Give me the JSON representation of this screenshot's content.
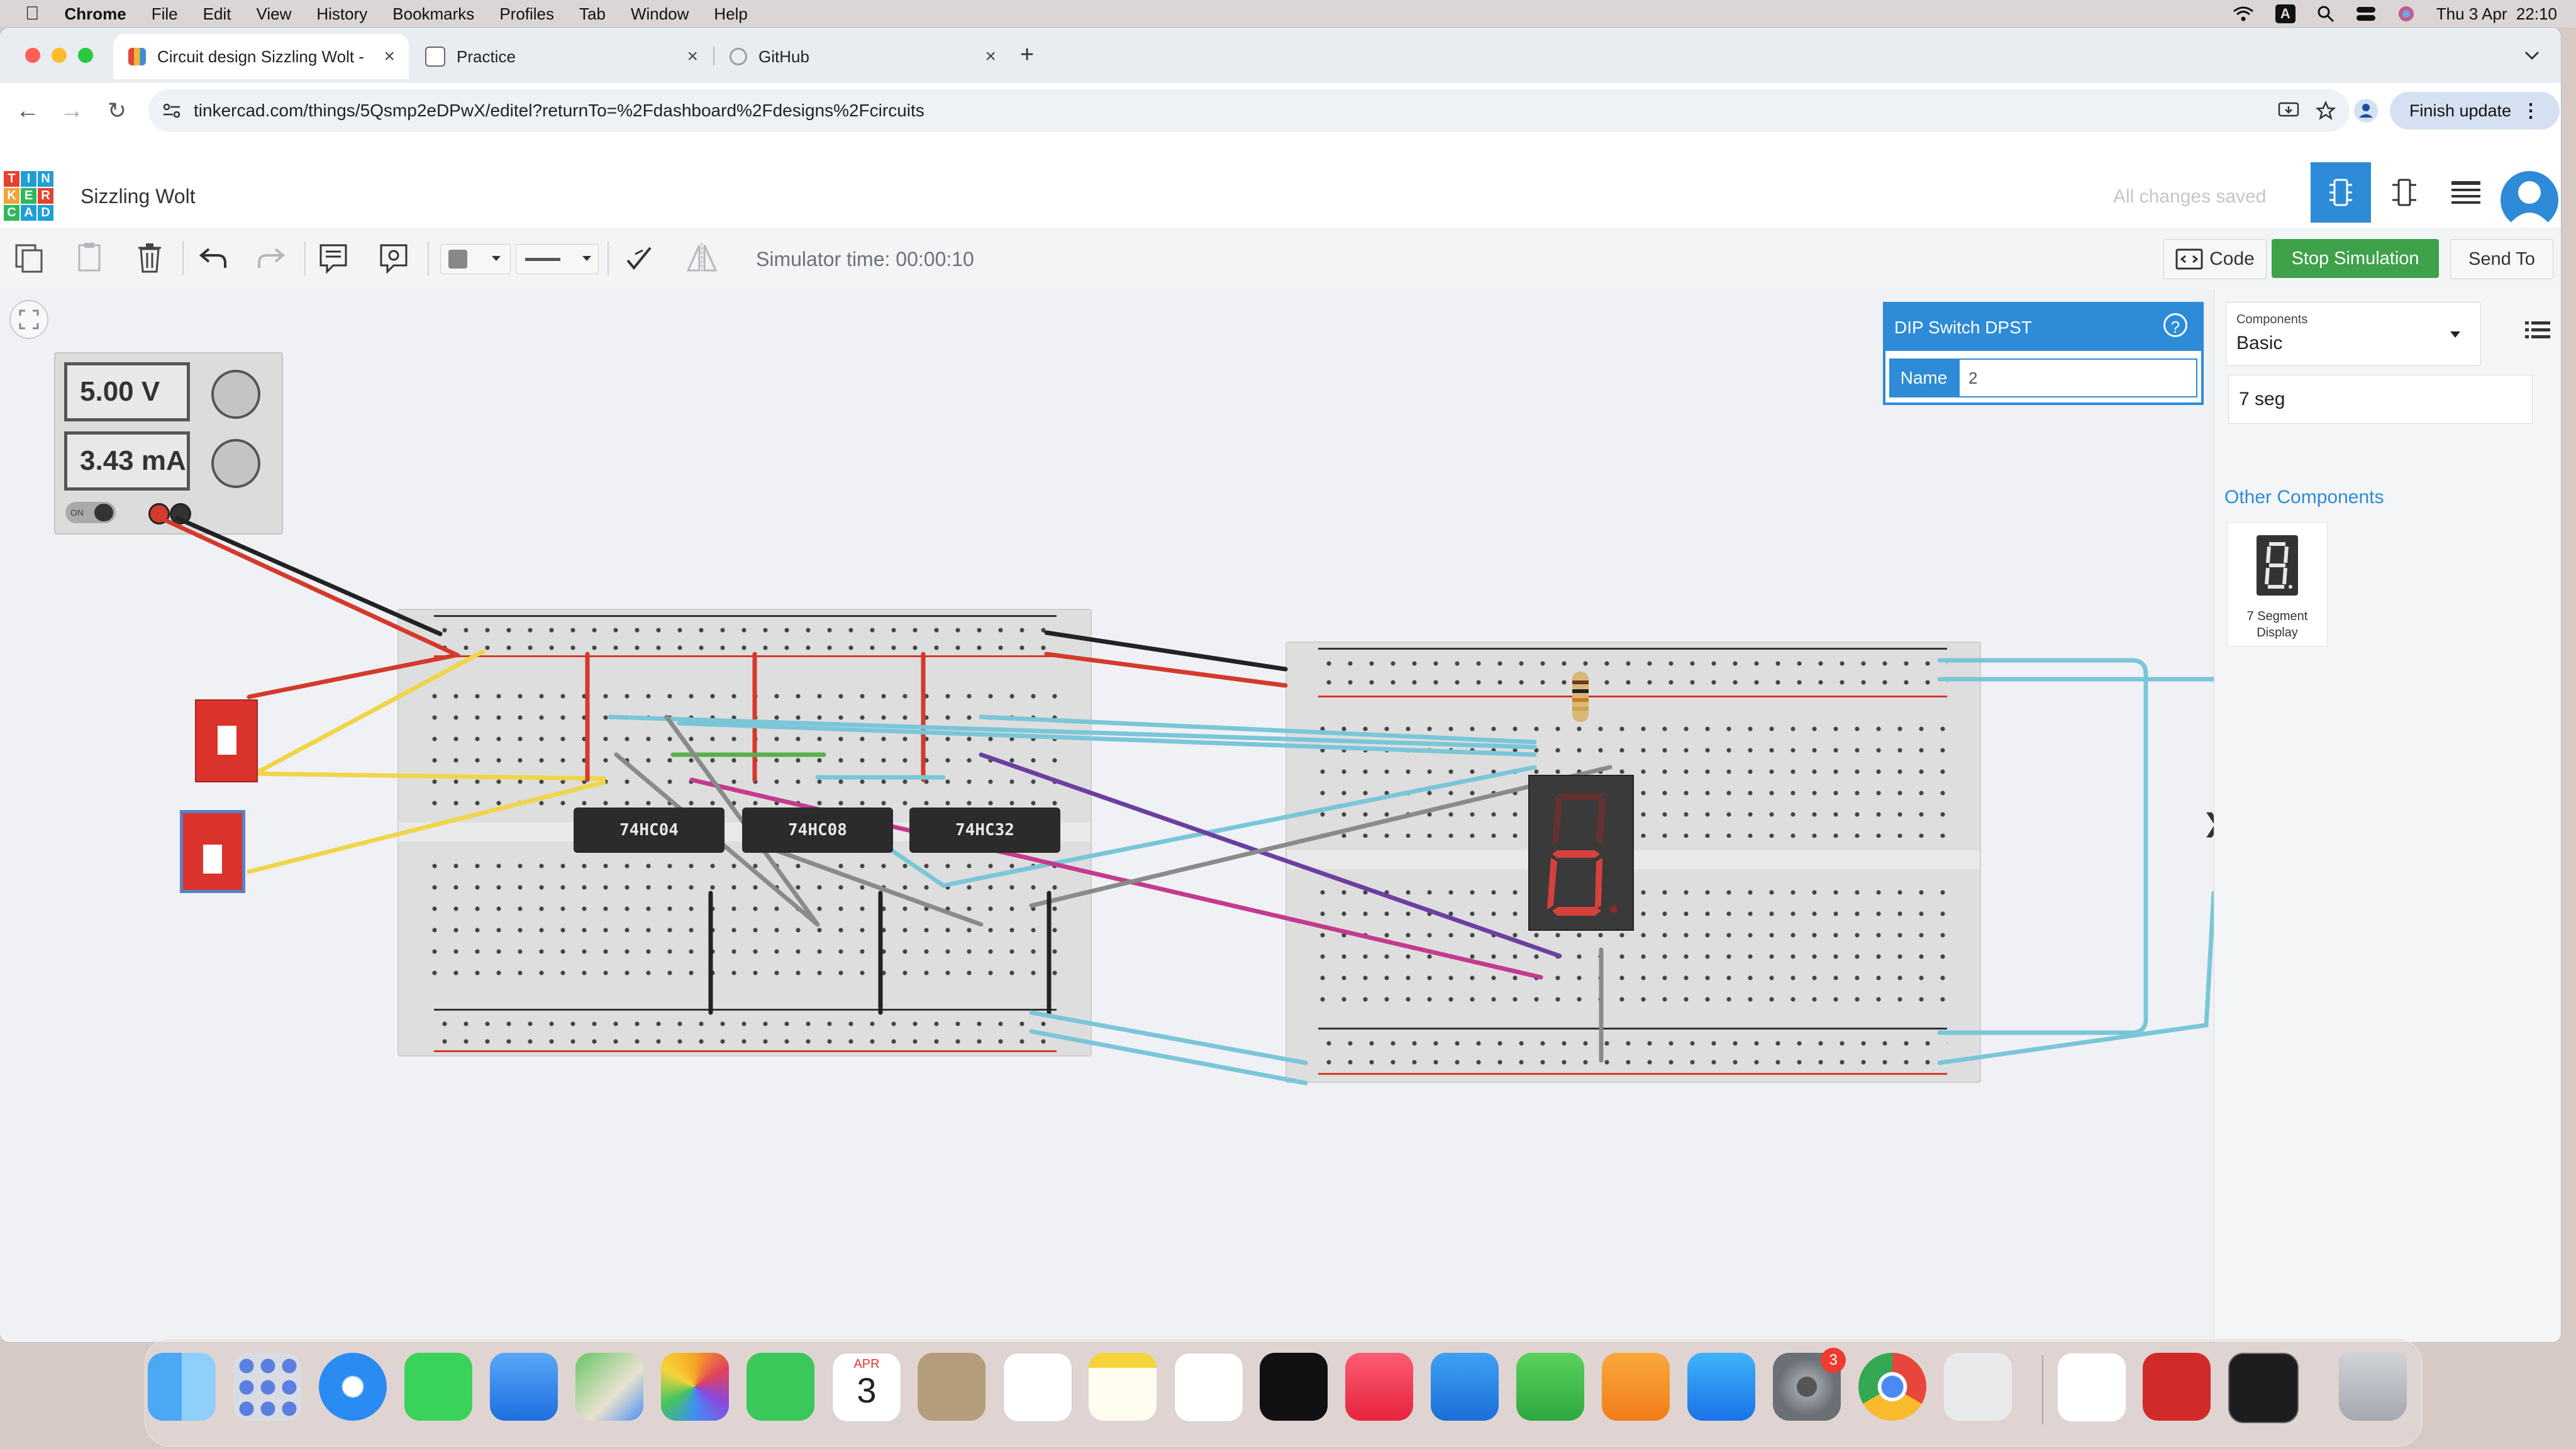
{
  "menubar": {
    "app": "Chrome",
    "items": [
      "File",
      "Edit",
      "View",
      "History",
      "Bookmarks",
      "Profiles",
      "Tab",
      "Window",
      "Help"
    ],
    "datetime": "Thu 3 Apr  22:10",
    "input_indicator": "A"
  },
  "tabs": [
    {
      "title": "Circuit design Sizzling Wolt -",
      "close": "×"
    },
    {
      "title": "Practice",
      "close": "×"
    },
    {
      "title": "GitHub",
      "close": "×"
    }
  ],
  "new_tab": "+",
  "url": "tinkercad.com/things/5Qsmp2eDPwX/editel?returnTo=%2Fdashboard%2Fdesigns%2Fcircuits",
  "finish_update": "Finish update",
  "tinkercad": {
    "logo": [
      "T",
      "I",
      "N",
      "K",
      "E",
      "R",
      "C",
      "A",
      "D"
    ],
    "design_name": "Sizzling Wolt",
    "save_status": "All changes saved"
  },
  "toolbar": {
    "sim_time": "Simulator time: 00:00:10",
    "code": "Code",
    "stop": "Stop Simulation",
    "send_to": "Send To"
  },
  "power_supply": {
    "voltage": "5.00 V",
    "current": "3.43 mA",
    "switch": "ON"
  },
  "chips": [
    "74HC04",
    "74HC08",
    "74HC32"
  ],
  "inspector": {
    "title": "DIP Switch DPST",
    "help": "?",
    "name_label": "Name",
    "name_value": "2"
  },
  "components_panel": {
    "caption": "Components",
    "selected": "Basic",
    "search_value": "7 seg",
    "other_heading": "Other Components",
    "item_label": "7 Segment Display"
  },
  "panel_toggle": "❯",
  "dock": {
    "calendar_month": "APR",
    "calendar_day": "3",
    "settings_badge": "3"
  },
  "colors": {
    "accent_blue": "#1a73e8",
    "tinkercad_blue": "#2d8bd8",
    "stop_green": "#3fa14a",
    "wire_red": "#d33a2c",
    "wire_black": "#222222",
    "wire_yellow": "#f0d548",
    "wire_teal": "#7ac6d8",
    "wire_purple": "#6b3fa0",
    "wire_magenta": "#c43a8e",
    "wire_gray": "#8a8a8a",
    "wire_green": "#58b04a"
  }
}
